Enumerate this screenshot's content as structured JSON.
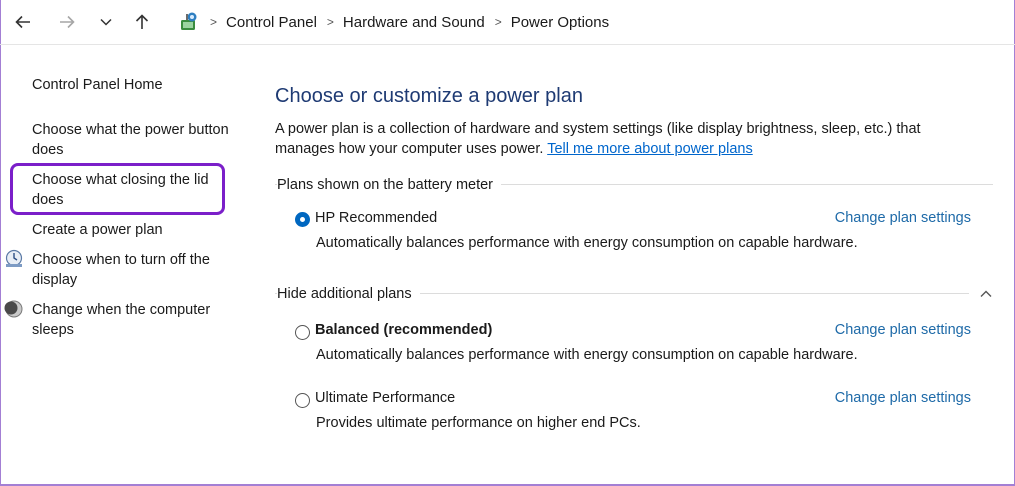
{
  "breadcrumb": [
    "Control Panel",
    "Hardware and Sound",
    "Power Options"
  ],
  "icons": {
    "back": "arrow-left-icon",
    "forward": "arrow-right-icon",
    "recent": "chevron-down-icon",
    "up": "arrow-up-icon",
    "location": "control-panel-icon"
  },
  "sidebar": {
    "items": [
      {
        "label": "Control Panel Home"
      },
      {
        "label": "Choose what the power button does"
      },
      {
        "label": "Choose what closing the lid does"
      },
      {
        "label": "Create a power plan"
      },
      {
        "label": "Choose when to turn off the display",
        "icon": "display-timer-icon"
      },
      {
        "label": "Change when the computer sleeps",
        "icon": "moon-sleep-icon"
      }
    ]
  },
  "main": {
    "title": "Choose or customize a power plan",
    "description": "A power plan is a collection of hardware and system settings (like display brightness, sleep, etc.) that manages how your computer uses power.",
    "learn_more": "Tell me more about power plans",
    "battery_section": "Plans shown on the battery meter",
    "additional_section": "Hide additional plans",
    "plans": [
      {
        "name": "HP Recommended",
        "description": "Automatically balances performance with energy consumption on capable hardware.",
        "selected": true,
        "bold": false,
        "link": "Change plan settings"
      },
      {
        "name": "Balanced (recommended)",
        "description": "Automatically balances performance with energy consumption on capable hardware.",
        "selected": false,
        "bold": true,
        "link": "Change plan settings"
      },
      {
        "name": "Ultimate Performance",
        "description": "Provides ultimate performance on higher end PCs.",
        "selected": false,
        "bold": false,
        "link": "Change plan settings"
      }
    ]
  },
  "colors": {
    "accent": "#0067c0",
    "title": "#1e3a73",
    "link": "#1e6aa8",
    "highlight": "#7b1fc9"
  }
}
